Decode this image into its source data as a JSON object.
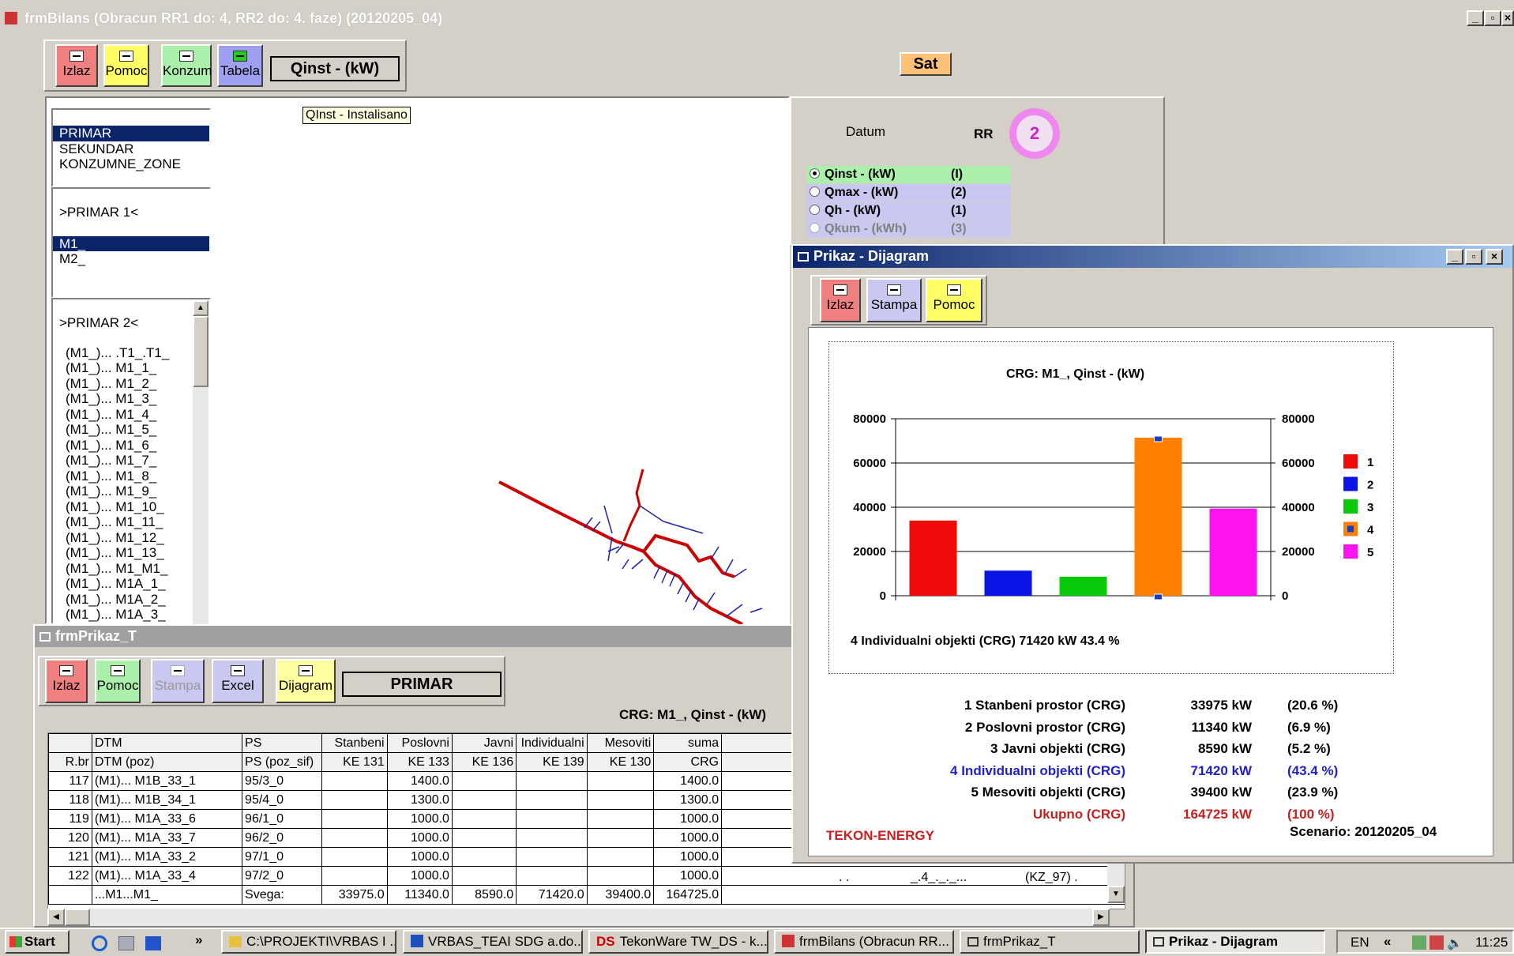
{
  "main": {
    "title": "frmBilans (Obracun RR1 do: 4, RR2 do: 4. faze)  (20120205_04)",
    "toolbar": {
      "izlaz": "Izlaz",
      "pomoc": "Pomoc",
      "konzum": "Konzum",
      "tabela": "Tabela",
      "mode": "Qinst - (kW)"
    },
    "sat_button": "Sat",
    "tooltip": "QInst - Instalisano",
    "level_list": [
      "PRIMAR",
      "SEKUNDAR",
      "KONZUMNE_ZONE"
    ],
    "group1_header": ">PRIMAR 1<",
    "group1_items": [
      "M1_",
      "M2_"
    ],
    "group2_header": ">PRIMAR 2<",
    "group2_items": [
      "(M1_)... .T1_.T1_",
      "(M1_)... M1_1_",
      "(M1_)... M1_2_",
      "(M1_)... M1_3_",
      "(M1_)... M1_4_",
      "(M1_)... M1_5_",
      "(M1_)... M1_6_",
      "(M1_)... M1_7_",
      "(M1_)... M1_8_",
      "(M1_)... M1_9_",
      "(M1_)... M1_10_",
      "(M1_)... M1_11_",
      "(M1_)... M1_12_",
      "(M1_)... M1_13_",
      "(M1_)... M1_M1_",
      "(M1_)... M1A_1_",
      "(M1_)... M1A_2_",
      "(M1_)... M1A_3_"
    ],
    "datum_label": "Datum",
    "rr_label": "RR",
    "rr_value": "2",
    "radio": [
      {
        "label": "Qinst - (kW)",
        "code": "(I)"
      },
      {
        "label": "Qmax - (kW)",
        "code": "(2)"
      },
      {
        "label": "Qh - (kW)",
        "code": "(1)"
      },
      {
        "label": "Qkum - (kWh)",
        "code": "(3)"
      }
    ]
  },
  "prikaz_t": {
    "title": "frmPrikaz_T",
    "toolbar": {
      "izlaz": "Izlaz",
      "pomoc": "Pomoc",
      "stampa": "Stampa",
      "excel": "Excel",
      "dijagram": "Dijagram",
      "level": "PRIMAR"
    },
    "caption": "CRG: M1_, Qinst - (kW)",
    "header1": [
      "",
      "DTM",
      "PS",
      "Stanbeni",
      "Poslovni",
      "Javni",
      "Individualni",
      "Mesoviti",
      "suma"
    ],
    "header2": [
      "R.br",
      "DTM (poz)",
      "PS (poz_sif)",
      "KE 131",
      "KE 133",
      "KE 136",
      "KE 139",
      "KE 130",
      "CRG"
    ],
    "rows": [
      [
        "117",
        "(M1)... M1B_33_1",
        "95/3_0",
        "",
        "1400.0",
        "",
        "",
        "",
        "1400.0"
      ],
      [
        "118",
        "(M1)... M1B_34_1",
        "95/4_0",
        "",
        "1300.0",
        "",
        "",
        "",
        "1300.0"
      ],
      [
        "119",
        "(M1)... M1A_33_6",
        "96/1_0",
        "",
        "1000.0",
        "",
        "",
        "",
        "1000.0"
      ],
      [
        "120",
        "(M1)... M1A_33_7",
        "96/2_0",
        "",
        "1000.0",
        "",
        "",
        "",
        "1000.0"
      ],
      [
        "121",
        "(M1)... M1A_33_2",
        "97/1_0",
        "",
        "1000.0",
        "",
        "",
        "",
        "1000.0"
      ],
      [
        "122",
        "(M1)... M1A_33_4",
        "97/2_0",
        "",
        "1000.0",
        "",
        "",
        "",
        "1000.0"
      ]
    ],
    "total": [
      "",
      "...M1...M1_",
      "Svega:",
      "33975.0",
      "11340.0",
      "8590.0",
      "71420.0",
      "39400.0",
      "164725.0"
    ],
    "extra_cells": [
      ". .",
      "_.4_._._...",
      "(KZ_97) ."
    ]
  },
  "dijagram": {
    "title": "Prikaz - Dijagram",
    "toolbar": {
      "izlaz": "Izlaz",
      "stampa": "Stampa",
      "pomoc": "Pomoc"
    },
    "selected_info": "4 Individualni objekti (CRG) 71420 kW 43.4 %",
    "stats": [
      {
        "label": "1 Stanbeni prostor (CRG)",
        "value": "33975 kW",
        "pct": "(20.6 %)"
      },
      {
        "label": "2 Poslovni prostor (CRG)",
        "value": "11340 kW",
        "pct": "(6.9 %)"
      },
      {
        "label": "3 Javni objekti (CRG)",
        "value": "8590 kW",
        "pct": "(5.2 %)"
      },
      {
        "label": "4 Individualni objekti (CRG)",
        "value": "71420 kW",
        "pct": "(43.4 %)"
      },
      {
        "label": "5 Mesoviti objekti (CRG)",
        "value": "39400 kW",
        "pct": "(23.9 %)"
      },
      {
        "label": "Ukupno (CRG)",
        "value": "164725 kW",
        "pct": "(100 %)"
      }
    ],
    "brand": "TEKON-ENERGY",
    "scenario": "Scenario:  20120205_04",
    "colors": {
      "selected": "#1f1fcc",
      "total": "#cc1f1f",
      "brand": "#cc1f1f"
    }
  },
  "chart_data": {
    "type": "bar",
    "title": "CRG: M1_, Qinst - (kW)",
    "categories": [
      "1",
      "2",
      "3",
      "4",
      "5"
    ],
    "values": [
      33975,
      11340,
      8590,
      71420,
      39400
    ],
    "colors": [
      "#f00a0a",
      "#0a14e6",
      "#0ac80a",
      "#ff7f00",
      "#ff14f0"
    ],
    "ylim": [
      0,
      80000
    ],
    "yticks": [
      0,
      20000,
      40000,
      60000,
      80000
    ],
    "legend": [
      "1",
      "2",
      "3",
      "4",
      "5"
    ],
    "legend_position": "right",
    "grid": true,
    "selected_index": 3
  },
  "taskbar": {
    "start": "Start",
    "chevron": "»",
    "items": [
      "C:\\PROJEKTI\\VRBAS I ...",
      "VRBAS_TEAI SDG a.do...",
      "TekonWare TW_DS - k...",
      "frmBilans (Obracun RR...",
      "frmPrikaz_T",
      "Prikaz - Dijagram"
    ],
    "lang": "EN",
    "tray_chevron": "«",
    "clock": "11:25"
  }
}
